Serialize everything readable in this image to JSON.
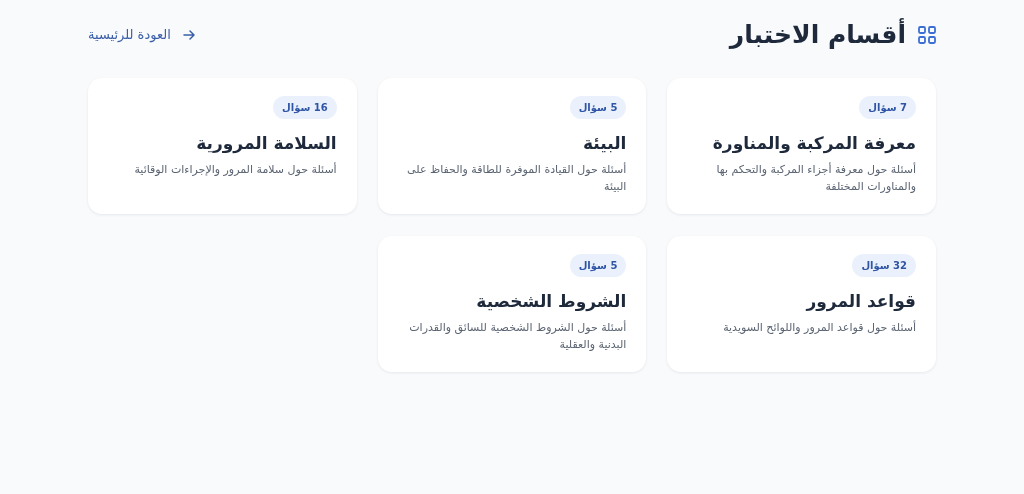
{
  "header": {
    "title": "أقسام الاختبار",
    "back_link": "العودة للرئيسية"
  },
  "categories": [
    {
      "count": "7 سؤال",
      "title": "معرفة المركبة والمناورة",
      "description": "أسئلة حول معرفة أجزاء المركبة والتحكم بها والمناورات المختلفة"
    },
    {
      "count": "5 سؤال",
      "title": "البيئة",
      "description": "أسئلة حول القيادة الموفرة للطاقة والحفاظ على البيئة"
    },
    {
      "count": "16 سؤال",
      "title": "السلامة المرورية",
      "description": "أسئلة حول سلامة المرور والإجراءات الوقائية"
    },
    {
      "count": "32 سؤال",
      "title": "قواعد المرور",
      "description": "أسئلة حول قواعد المرور واللوائح السويدية"
    },
    {
      "count": "5 سؤال",
      "title": "الشروط الشخصية",
      "description": "أسئلة حول الشروط الشخصية للسائق والقدرات البدنية والعقلية"
    }
  ]
}
